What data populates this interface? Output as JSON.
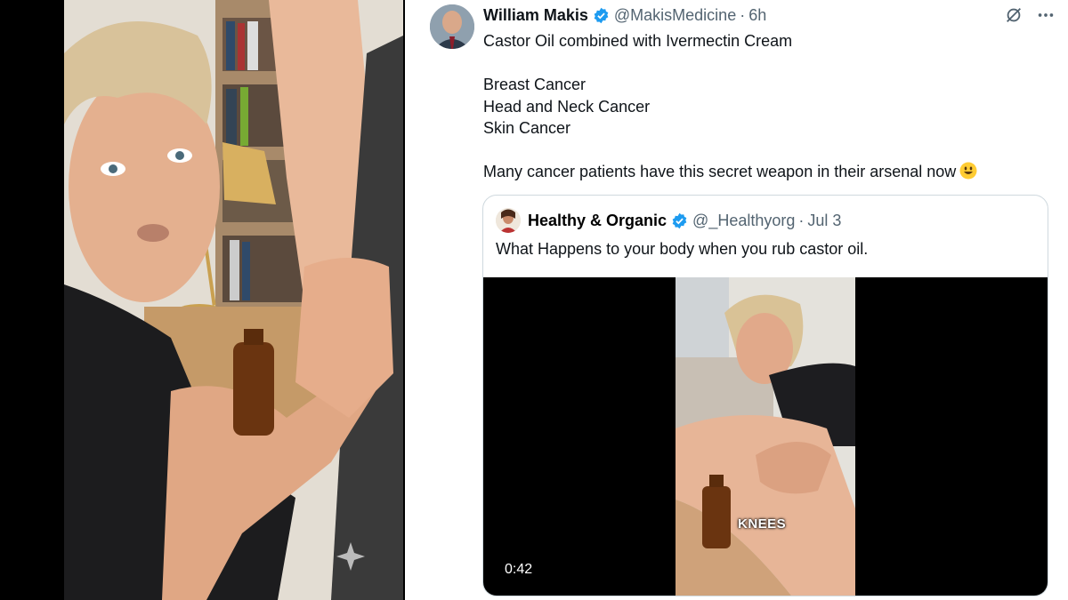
{
  "tweet": {
    "author_name": "William Makis",
    "author_handle": "@MakisMedicine",
    "separator": "·",
    "time": "6h",
    "line1": "Castor Oil combined with Ivermectin Cream",
    "line2": "Breast Cancer",
    "line3": "Head and Neck Cancer",
    "line4": "Skin Cancer",
    "line5": "Many cancer patients have this secret weapon in their arsenal now",
    "emoji": "smiley-emoji"
  },
  "quote": {
    "author_name": "Healthy & Organic",
    "author_handle": "@_Healthyorg",
    "separator": "·",
    "date": "Jul 3",
    "text": "What Happens to your body when you rub castor oil.",
    "video_caption": "KNEES",
    "video_duration": "0:42"
  },
  "icons": [
    "verified-badge-icon",
    "grok-icon",
    "more-options-icon",
    "sparkle-icon"
  ],
  "colors": {
    "verified": "#1d9bf0",
    "text": "#0f1419",
    "secondary": "#536471",
    "border": "#cfd9de"
  }
}
